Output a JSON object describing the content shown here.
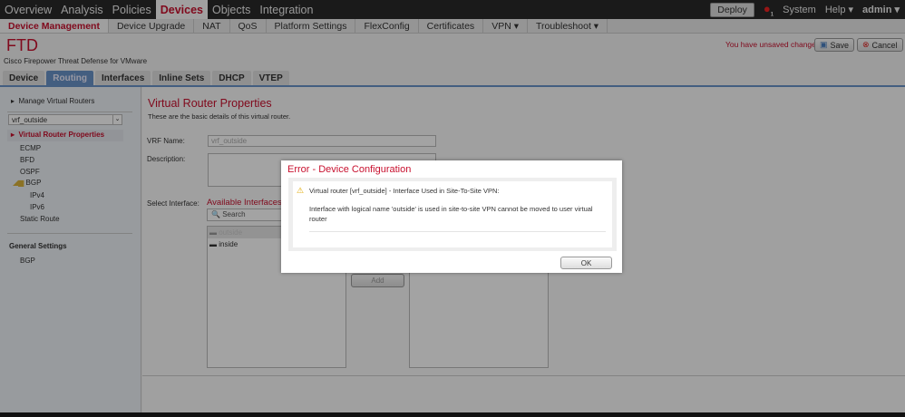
{
  "topnav": {
    "items": [
      "Overview",
      "Analysis",
      "Policies",
      "Devices",
      "Objects",
      "Integration"
    ],
    "deploy": "Deploy",
    "alert_count": "1",
    "system": "System",
    "help": "Help ▾",
    "user": "admin ▾"
  },
  "subnav": {
    "items": [
      "Device Management",
      "Device Upgrade",
      "NAT",
      "QoS",
      "Platform Settings",
      "FlexConfig",
      "Certificates",
      "VPN ▾",
      "Troubleshoot ▾"
    ]
  },
  "header": {
    "title": "FTD",
    "subtitle": "Cisco Firepower Threat Defense for VMware",
    "unsaved": "You have unsaved changes",
    "save": "Save",
    "cancel": "Cancel"
  },
  "tabs": [
    "Device",
    "Routing",
    "Interfaces",
    "Inline Sets",
    "DHCP",
    "VTEP"
  ],
  "sidebar": {
    "manage": "Manage Virtual Routers",
    "vrf_select": "vrf_outside",
    "items": [
      "Virtual Router Properties",
      "ECMP",
      "BFD",
      "OSPF",
      "BGP",
      "IPv4",
      "IPv6",
      "Static Route"
    ],
    "general_heading": "General Settings",
    "general_items": [
      "BGP"
    ]
  },
  "main": {
    "heading": "Virtual Router Properties",
    "description": "These are the basic details of this virtual router.",
    "vrf_label": "VRF Name:",
    "vrf_value": "vrf_outside",
    "desc_label": "Description:",
    "select_label": "Select Interface:",
    "available": "Available Interfaces",
    "search_placeholder": "Search",
    "interfaces": [
      "outside",
      "inside"
    ],
    "add": "Add"
  },
  "dialog": {
    "title": "Error - Device Configuration",
    "line1": "Virtual router [vrf_outside] -  Interface Used in Site-To-Site VPN:",
    "line2": "Interface with logical name 'outside' is used in site-to-site VPN cannot be moved to user virtual router",
    "ok": "OK"
  }
}
